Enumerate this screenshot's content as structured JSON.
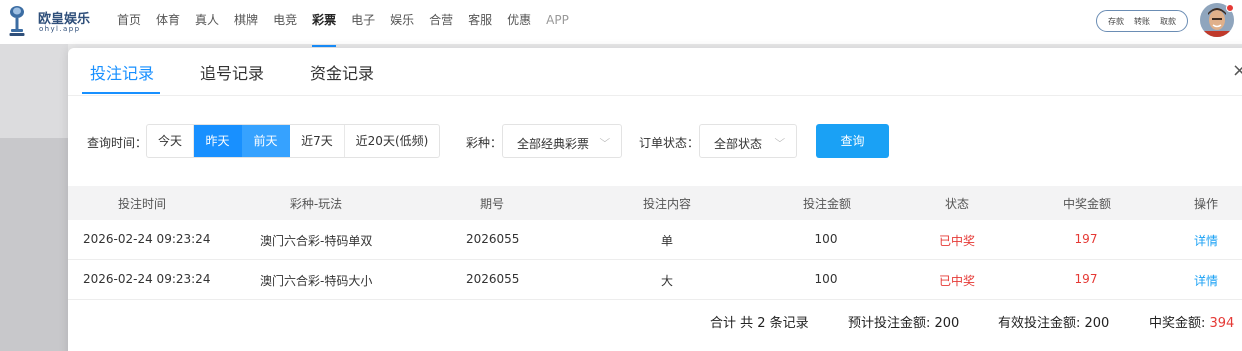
{
  "brand": {
    "name": "欧皇娱乐",
    "domain": "ohyl.app"
  },
  "nav": {
    "items": [
      "首页",
      "体育",
      "真人",
      "棋牌",
      "电竞",
      "彩票",
      "电子",
      "娱乐",
      "合营",
      "客服",
      "优惠",
      "APP"
    ],
    "active": "彩票"
  },
  "wallet": {
    "deposit": "存款",
    "transfer": "转账",
    "withdraw": "取款"
  },
  "modal": {
    "tabs": [
      "投注记录",
      "追号记录",
      "资金记录"
    ],
    "active_tab": "投注记录",
    "close": "×"
  },
  "filters": {
    "time_label": "查询时间：",
    "time_options": [
      "今天",
      "昨天",
      "前天",
      "近7天",
      "近20天(低频)"
    ],
    "time_selected": [
      "昨天",
      "前天"
    ],
    "lottery_label": "彩种：",
    "lottery_value": "全部经典彩票",
    "status_label": "订单状态：",
    "status_value": "全部状态",
    "query_button": "查询"
  },
  "table": {
    "headers": [
      "投注时间",
      "彩种-玩法",
      "期号",
      "投注内容",
      "投注金额",
      "状态",
      "中奖金额",
      "操作"
    ],
    "rows": [
      {
        "time": "2026-02-24 09:23:24",
        "game": "澳门六合彩-特码单双",
        "issue": "2026055",
        "content": "单",
        "amount": "100",
        "status": "已中奖",
        "win": "197",
        "action": "详情"
      },
      {
        "time": "2026-02-24 09:23:24",
        "game": "澳门六合彩-特码大小",
        "issue": "2026055",
        "content": "大",
        "amount": "100",
        "status": "已中奖",
        "win": "197",
        "action": "详情"
      }
    ]
  },
  "summary": {
    "count_text": "合计 共 2 条记录",
    "estimated_label": "预计投注金额: ",
    "estimated_value": "200",
    "valid_label": "有效投注金额: ",
    "valid_value": "200",
    "win_label": "中奖金额: ",
    "win_value": "394"
  },
  "colors": {
    "accent": "#1890ff",
    "win_red": "#e53935",
    "link": "#1aa1f5"
  },
  "icons": {
    "logo": "trophy-icon",
    "avatar": "user-avatar",
    "chevron": "chevron-down-icon"
  }
}
